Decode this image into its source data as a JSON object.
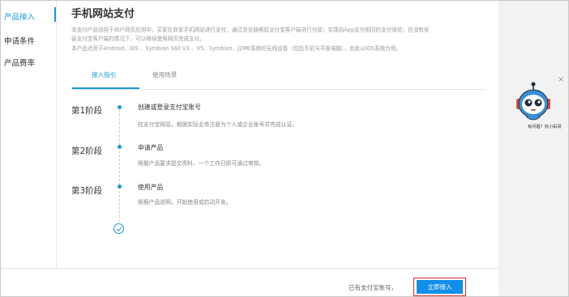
{
  "sidebar": {
    "items": [
      {
        "label": "产品接入",
        "active": true
      },
      {
        "label": "申请条件",
        "active": false
      },
      {
        "label": "产品费率",
        "active": false
      }
    ]
  },
  "main": {
    "title": "手机网站支付",
    "description": [
      "本支付产品适用于商户网页应用中，买家在商家手机网站进行支付，通过浏览器唤起支付宝客户端进行付款；实现向App支付相同的支付体验；在没有安",
      "装支付宝客户端的情况下，可以继续使用网页完成支付。",
      "本产品适用于Android、iOS 、Symbian S60 V3 、V5、Symbian、J2ME系统的无线设备（包括手机与平板电脑），此处以iOS系统为例。"
    ],
    "tabs": [
      {
        "label": "接入指引",
        "active": true
      },
      {
        "label": "使用场景",
        "active": false
      }
    ],
    "stages": [
      {
        "label": "第1阶段",
        "title": "创建或登录支付宝账号",
        "desc": "在支付宝网站，根据实际业务注册为个人或企业账号并完成认证。"
      },
      {
        "label": "第2阶段",
        "title": "申请产品",
        "desc": "根据产品要求提交资料，一个工作日即可通过审核。"
      },
      {
        "label": "第3阶段",
        "title": "使用产品",
        "desc": "根据产品说明，开始使用或启动开发。"
      }
    ]
  },
  "footer": {
    "text": "已有支付宝账号，",
    "button_label": "立即接入"
  },
  "help": {
    "close_symbol": "×",
    "label": "有问题？找小蚂哥"
  },
  "colors": {
    "accent": "#1a98d5",
    "button": "#108ee9",
    "highlight_outline": "#e0282b"
  },
  "icons": {
    "close": "close-icon",
    "robot": "robot-assistant-icon",
    "check": "check-circle-icon"
  }
}
